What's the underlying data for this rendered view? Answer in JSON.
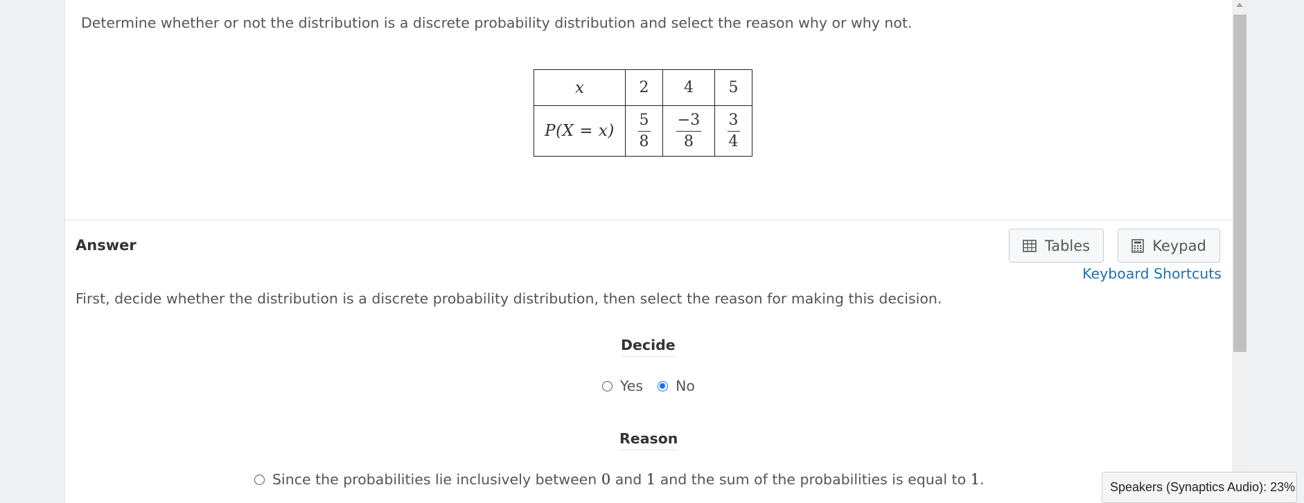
{
  "question": {
    "text": "Determine whether or not the distribution is a discrete probability distribution and select the reason why or why not."
  },
  "table": {
    "row1_label": "x",
    "row2_label": "P(X = x)",
    "x_values": [
      "2",
      "4",
      "5"
    ],
    "probabilities": [
      {
        "num": "5",
        "den": "8"
      },
      {
        "num": "−3",
        "den": "8"
      },
      {
        "num": "3",
        "den": "4"
      }
    ]
  },
  "answer": {
    "heading": "Answer",
    "tables_button": "Tables",
    "keypad_button": "Keypad",
    "shortcuts_link": "Keyboard Shortcuts",
    "instructions": "First, decide whether the distribution is a discrete probability distribution, then select the reason for making this decision.",
    "decide_title": "Decide",
    "yes_label": "Yes",
    "no_label": "No",
    "selected": "No",
    "reason_title": "Reason",
    "reason_option": {
      "part1": "Since the probabilities lie inclusively between ",
      "num0": "0",
      "part2": " and ",
      "num1": "1",
      "part3": " and the sum of the probabilities is equal to ",
      "num1b": "1",
      "part4": "."
    }
  },
  "tooltip": {
    "text": "Speakers (Synaptics Audio): 23%"
  },
  "colors": {
    "accent": "#1a73e8",
    "link": "#1f6fb2"
  }
}
